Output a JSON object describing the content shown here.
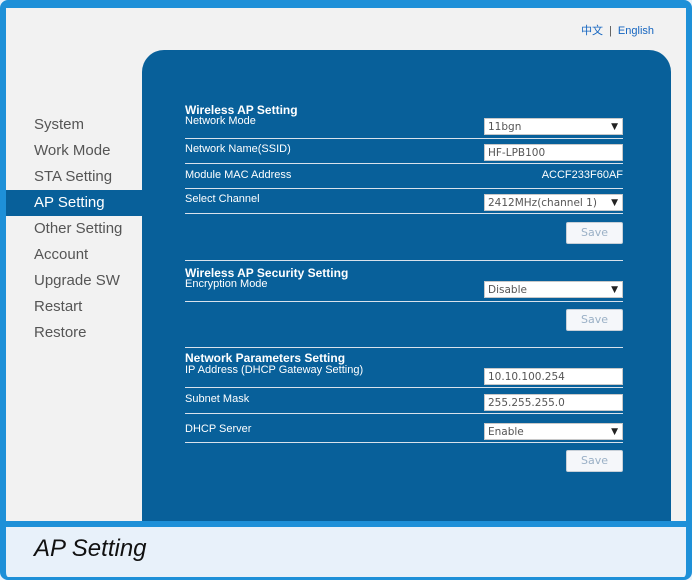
{
  "language": {
    "chinese": "中文",
    "separator": "|",
    "english": "English"
  },
  "nav": [
    {
      "label": "System"
    },
    {
      "label": "Work Mode"
    },
    {
      "label": "STA Setting"
    },
    {
      "label": "AP Setting",
      "active": true
    },
    {
      "label": "Other Setting"
    },
    {
      "label": "Account"
    },
    {
      "label": "Upgrade SW"
    },
    {
      "label": "Restart"
    },
    {
      "label": "Restore"
    }
  ],
  "wireless": {
    "title": "Wireless AP Setting",
    "network_mode_label": "Network Mode",
    "network_mode_value": "11bgn",
    "ssid_label": "Network Name(SSID)",
    "ssid_value": "HF-LPB100",
    "mac_label": "Module MAC Address",
    "mac_value": "ACCF233F60AF",
    "channel_label": "Select Channel",
    "channel_value": "2412MHz(channel 1)",
    "save_label": "Save"
  },
  "security": {
    "title": "Wireless AP Security Setting",
    "encryption_label": "Encryption Mode",
    "encryption_value": "Disable",
    "save_label": "Save"
  },
  "network": {
    "title": "Network Parameters Setting",
    "ip_label": "IP Address (DHCP Gateway Setting)",
    "ip_value": "10.10.100.254",
    "mask_label": "Subnet Mask",
    "mask_value": "255.255.255.0",
    "dhcp_label": "DHCP Server",
    "dhcp_value": "Enable",
    "save_label": "Save"
  },
  "caption": "AP Setting",
  "colors": {
    "accent": "#1e90d8",
    "panel": "#08609a",
    "page_bg": "#f2f2f2"
  }
}
